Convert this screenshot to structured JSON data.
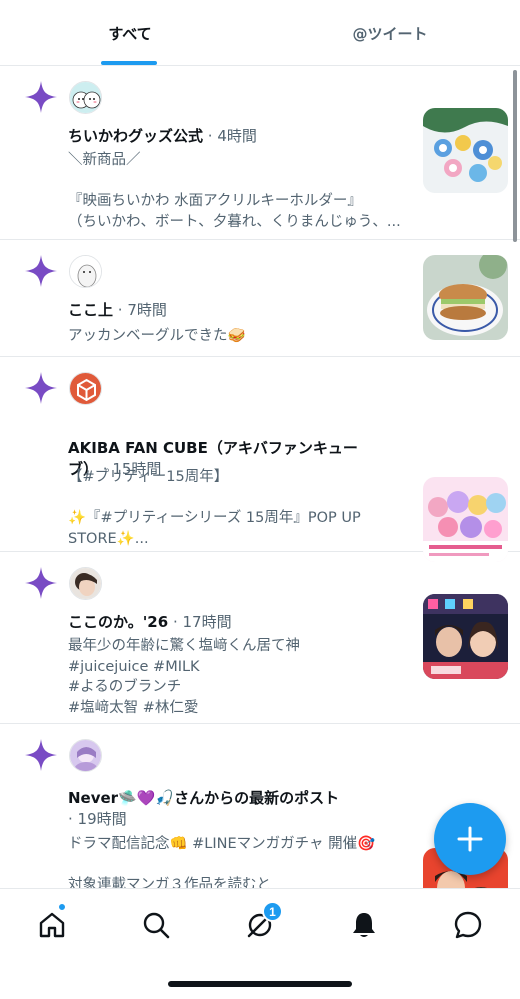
{
  "tabs": [
    {
      "label": "すべて",
      "active": true
    },
    {
      "label": "@ツイート",
      "active": false
    }
  ],
  "notifications": [
    {
      "name": "ちいかわグッズ公式",
      "meta": " · 4時間",
      "body": "＼新商品／\n\n『映画ちいかわ 水面アクリルキーホルダー』\n（ちいかわ、ボート、夕暮れ、くりまんじゅう、..."
    },
    {
      "name": "ここ上",
      "meta": " · 7時間",
      "body": "アッカンベーグルできた🥪"
    },
    {
      "name": "AKIBA FAN CUBE（アキバファンキュー\nブ）",
      "meta": " · 15時間",
      "body": "【#プリティー15周年】\n\n✨『#プリティーシリーズ 15周年』POP UP\nSTORE✨..."
    },
    {
      "name": "ここのか。'26",
      "meta": " · 17時間",
      "body": "最年少の年齢に驚く塩﨑くん居て神\n#juicejuice #MILK\n#よるのブランチ\n#塩﨑太智 #林仁愛"
    },
    {
      "name": "Never🛸💜🎣さんからの最新のポスト",
      "meta": "· 19時間",
      "body": "ドラマ配信記念👊 #LINEマンガガチャ 開催🎯\n\n対象連載マンガ３作品を読むと"
    }
  ],
  "nav": {
    "badge_count": "1",
    "icons": [
      "home-icon",
      "search-icon",
      "spaces-icon",
      "bell-icon",
      "messages-icon"
    ]
  },
  "colors": {
    "accent": "#1d9bf0",
    "sparkle": "#794bc4",
    "secondary_text": "#536471"
  }
}
